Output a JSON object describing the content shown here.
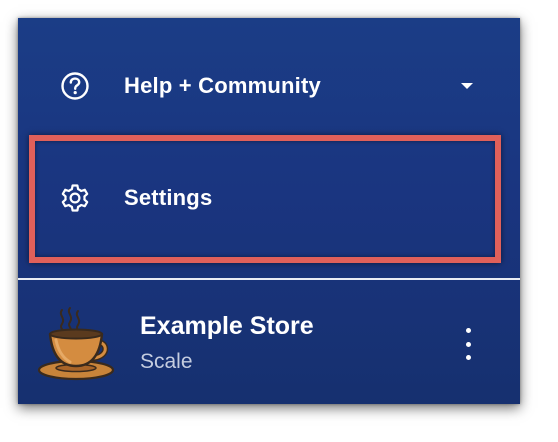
{
  "menu": {
    "items": [
      {
        "label": "Help + Community",
        "icon": "question-circle-icon",
        "has_dropdown": true
      },
      {
        "label": "Settings",
        "icon": "gear-icon",
        "highlighted": true
      }
    ]
  },
  "store": {
    "name": "Example Store",
    "plan": "Scale",
    "logo": "coffee-cup-icon"
  },
  "colors": {
    "panel_background": "#1a3580",
    "highlight_border": "#e0605a",
    "text": "#ffffff",
    "muted_text": "#c5cde0"
  }
}
